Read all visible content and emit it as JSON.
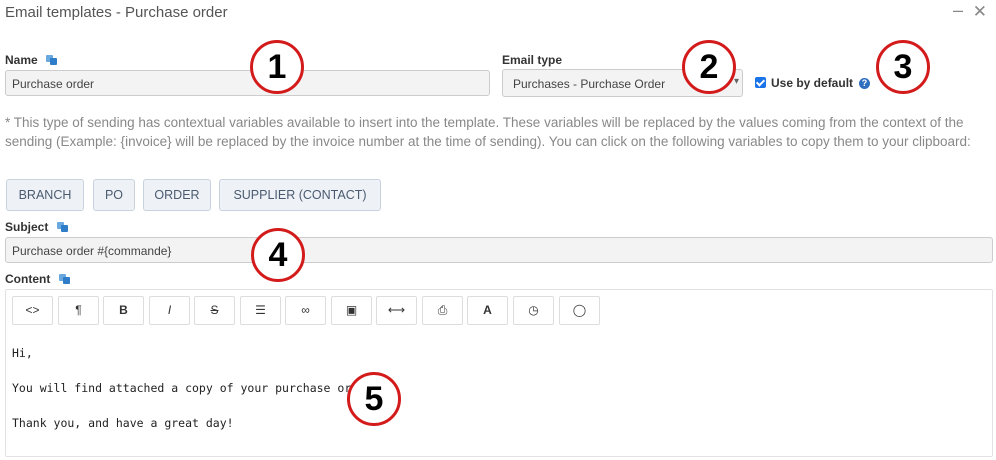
{
  "window": {
    "title": "Email templates - Purchase order",
    "minimize_glyph": "–",
    "close_glyph": "✕"
  },
  "name_field": {
    "label": "Name",
    "value": "Purchase order"
  },
  "email_type": {
    "label": "Email type",
    "selected": "Purchases - Purchase Order"
  },
  "use_by_default": {
    "label": "Use by default",
    "checked": true,
    "help_glyph": "?"
  },
  "info_text": "* This type of sending has contextual variables available to insert into the template. These variables will be replaced by the values coming from the context of the sending (Example: {invoice} will be replaced by the invoice number at the time of sending). You can click on the following variables to copy them to your clipboard:",
  "variables": [
    "BRANCH",
    "PO",
    "ORDER",
    "SUPPLIER (CONTACT)"
  ],
  "subject": {
    "label": "Subject",
    "value": "Purchase order #{commande}"
  },
  "content": {
    "label": "Content",
    "toolbar": [
      {
        "name": "code-view-icon",
        "glyph": "<>"
      },
      {
        "name": "paragraph-icon",
        "glyph": "¶"
      },
      {
        "name": "bold-icon",
        "glyph": "B"
      },
      {
        "name": "italic-icon",
        "glyph": "I"
      },
      {
        "name": "strikethrough-icon",
        "glyph": "S"
      },
      {
        "name": "list-icon",
        "glyph": "☰"
      },
      {
        "name": "link-icon",
        "glyph": "∞"
      },
      {
        "name": "image-icon",
        "glyph": "▣"
      },
      {
        "name": "horizontal-rule-icon",
        "glyph": "⟷"
      },
      {
        "name": "print-icon",
        "glyph": "⎙"
      },
      {
        "name": "text-style-icon",
        "glyph": "A"
      },
      {
        "name": "clock-icon",
        "glyph": "◷"
      },
      {
        "name": "comment-icon",
        "glyph": "◯"
      }
    ],
    "lines": [
      "Hi,",
      "You will find attached a copy of your purchase order.",
      "Thank you, and have a great day!"
    ]
  },
  "markers": [
    "1",
    "2",
    "3",
    "4",
    "5"
  ],
  "colors": {
    "accent": "#1a73e8",
    "marker_border": "#d31b1b",
    "variable_button_bg": "#eef2f6"
  }
}
